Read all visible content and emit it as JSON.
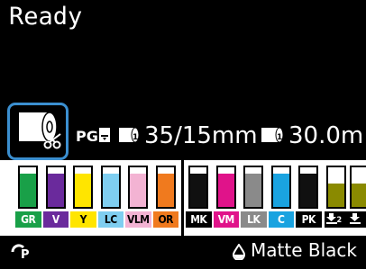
{
  "status": "Ready",
  "paper": {
    "roll1": "35/15mm",
    "roll2": "30.0m"
  },
  "inks_left": [
    {
      "code": "GR",
      "color": "#19a048",
      "label_bg": "#19a048",
      "label_fg": "#fff",
      "level": 0.95
    },
    {
      "code": "V",
      "color": "#6a2a9c",
      "label_bg": "#6a2a9c",
      "label_fg": "#fff",
      "level": 0.95
    },
    {
      "code": "Y",
      "color": "#ffe500",
      "label_bg": "#ffe500",
      "label_fg": "#000",
      "level": 0.95
    },
    {
      "code": "LC",
      "color": "#7fcef0",
      "label_bg": "#7fcef0",
      "label_fg": "#000",
      "level": 0.95
    },
    {
      "code": "VLM",
      "color": "#f3b3d3",
      "label_bg": "#f3b3d3",
      "label_fg": "#000",
      "level": 0.95
    },
    {
      "code": "OR",
      "color": "#f07a1e",
      "label_bg": "#f07a1e",
      "label_fg": "#000",
      "level": 0.95
    }
  ],
  "inks_right": [
    {
      "code": "MK",
      "color": "#101010",
      "label_bg": "#000",
      "label_fg": "#fff",
      "level": 0.95
    },
    {
      "code": "VM",
      "color": "#e0138a",
      "label_bg": "#e0138a",
      "label_fg": "#fff",
      "level": 0.95
    },
    {
      "code": "LK",
      "color": "#8a8a8a",
      "label_bg": "#8a8a8a",
      "label_fg": "#fff",
      "level": 0.95
    },
    {
      "code": "C",
      "color": "#1aa3e0",
      "label_bg": "#1aa3e0",
      "label_fg": "#fff",
      "level": 0.95
    },
    {
      "code": "PK",
      "color": "#101010",
      "label_bg": "#000",
      "label_fg": "#fff",
      "level": 0.95
    }
  ],
  "maintenance": [
    {
      "code": "2",
      "level": 0.6
    },
    {
      "code": "",
      "level": 0.6
    }
  ],
  "footer": {
    "left": "ᵋP",
    "black_ink": "Matte Black"
  }
}
